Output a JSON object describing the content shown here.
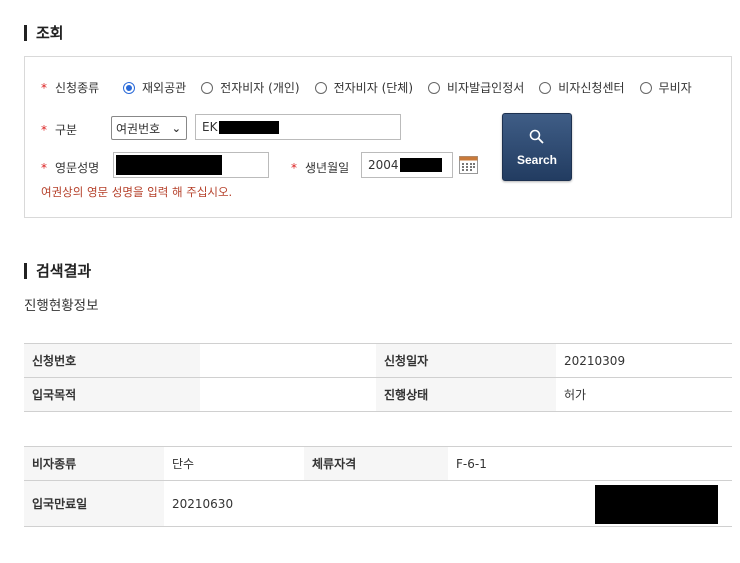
{
  "sections": {
    "search_title": "조회",
    "result_title": "검색결과",
    "progress_title": "진행현황정보"
  },
  "search": {
    "visa_type_label": "신청종류",
    "visa_types": [
      "재외공관",
      "전자비자 (개인)",
      "전자비자 (단체)",
      "비자발급인정서",
      "비자신청센터",
      "무비자"
    ],
    "selected_visa_type": "재외공관",
    "category_label": "구분",
    "category_select_value": "여권번호",
    "passport_value": "EK",
    "name_label": "영문성명",
    "name_value": "",
    "birth_label": "생년월일",
    "birth_value": "2004",
    "hint": "여권상의 영문 성명을 입력 해 주십시오.",
    "button_label": "Search",
    "icons": {
      "search": "magnifier-icon",
      "calendar": "calendar-icon",
      "select": "chevron-down-icon"
    }
  },
  "result": {
    "application_number_label": "신청번호",
    "application_number": "",
    "application_date_label": "신청일자",
    "application_date": "20210309",
    "entry_purpose_label": "입국목적",
    "entry_purpose": "",
    "status_label": "진행상태",
    "status": "허가",
    "visa_kind_label": "비자종류",
    "visa_kind": "단수",
    "stay_status_label": "체류자격",
    "stay_status": "F-6-1",
    "entry_expiry_label": "입국만료일",
    "entry_expiry": "20210630"
  },
  "colors": {
    "required": "#dd2222",
    "hint": "#b5402a",
    "button": "#2d4a73",
    "radio_selected": "#2a6ad8"
  }
}
